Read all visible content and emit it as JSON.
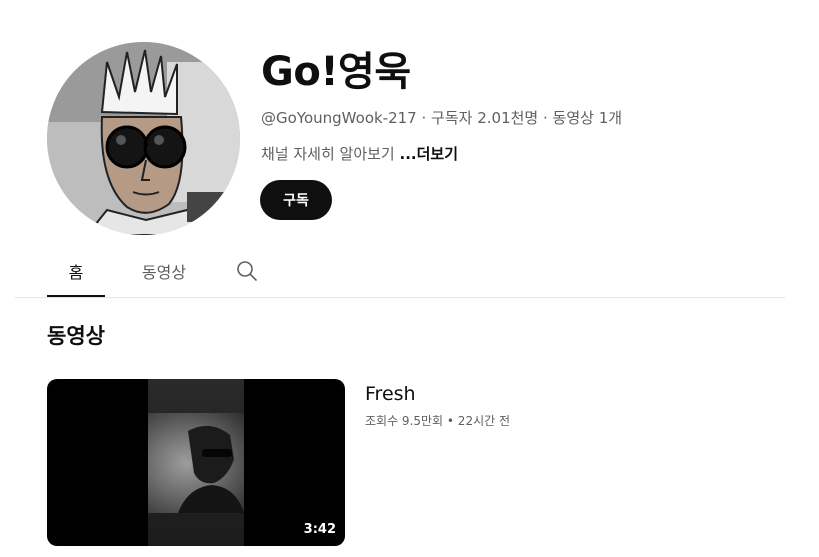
{
  "channel": {
    "name": "Go!영욱",
    "handle": "@GoYoungWook-217",
    "separator": " · ",
    "subscribers": "구독자 2.01천명",
    "video_count": "동영상 1개",
    "description": "채널 자세히 알아보기 ",
    "more_label": "...더보기",
    "subscribe_label": "구독",
    "avatar_icon": "cartoon-avatar"
  },
  "tabs": [
    {
      "label": "홈",
      "active": true
    },
    {
      "label": "동영상",
      "active": false
    },
    {
      "icon": "search-icon"
    }
  ],
  "section": {
    "title": "동영상"
  },
  "videos": [
    {
      "title": "Fresh",
      "meta": "조회수 9.5만회 • 22시간 전",
      "duration": "3:42"
    }
  ],
  "colors": {
    "text_primary": "#0f0f0f",
    "text_secondary": "#606060",
    "subscribe_bg": "#0f0f0f",
    "divider": "#e5e5e5"
  }
}
